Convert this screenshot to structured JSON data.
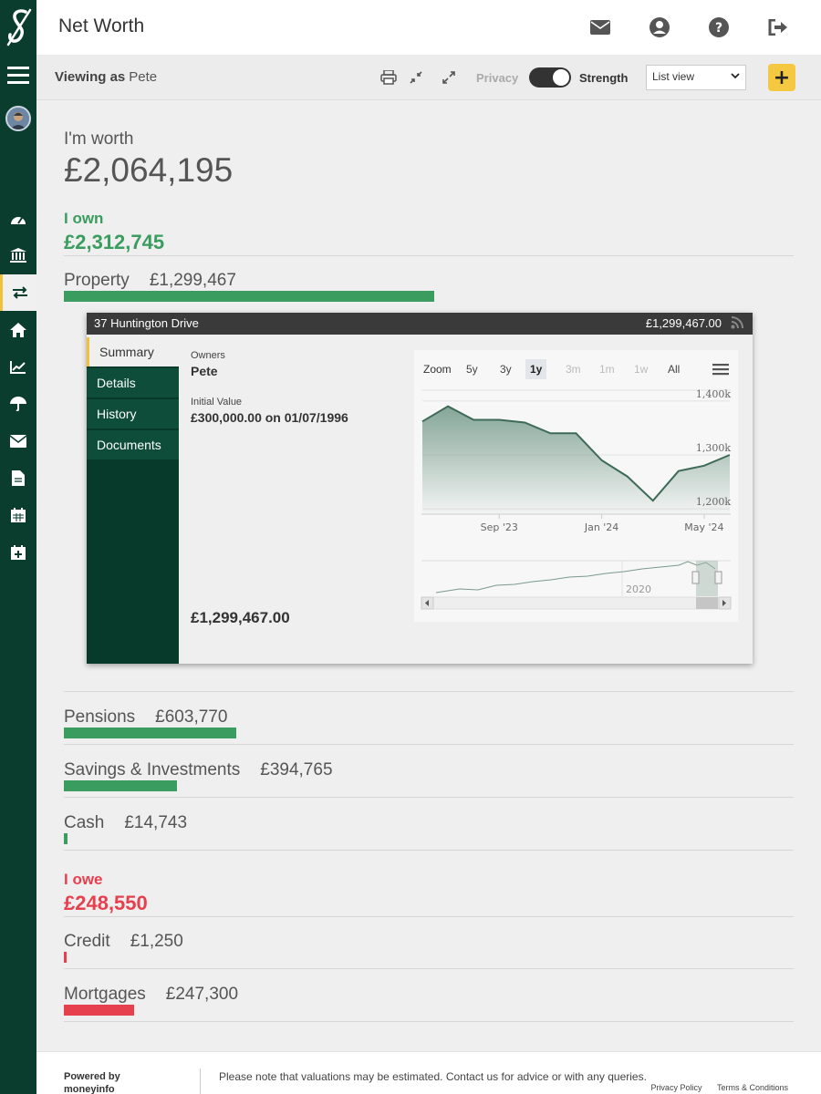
{
  "header": {
    "title": "Net Worth"
  },
  "toolbar": {
    "viewing_as_label": "Viewing as",
    "viewing_as_name": "Pete",
    "privacy_label": "Privacy",
    "strength_label": "Strength",
    "view_select_value": "List view",
    "privacy_enabled": true,
    "add_label": "+"
  },
  "summary": {
    "worth_label": "I'm worth",
    "worth_value": "£2,064,195",
    "own_label": "I own",
    "own_value": "£2,312,745",
    "owe_label": "I owe",
    "owe_value": "£248,550"
  },
  "assets": [
    {
      "name": "Property",
      "amount": "£1,299,467",
      "share": 0.562
    },
    {
      "name": "Pensions",
      "amount": "£603,770",
      "share": 0.261
    },
    {
      "name": "Savings & Investments",
      "amount": "£394,765",
      "share": 0.171
    },
    {
      "name": "Cash",
      "amount": "£14,743",
      "share": 0.006
    }
  ],
  "liabilities": [
    {
      "name": "Credit",
      "amount": "£1,250",
      "share": 0.005
    },
    {
      "name": "Mortgages",
      "amount": "£247,300",
      "share": 0.995
    }
  ],
  "property_panel": {
    "name": "37 Huntington Drive",
    "value": "£1,299,467.00",
    "tabs": [
      "Summary",
      "Details",
      "History",
      "Documents"
    ],
    "active_tab": "Summary",
    "owners_label": "Owners",
    "owners_value": "Pete",
    "initial_value_label": "Initial Value",
    "initial_value": "£300,000.00 on 01/07/1996",
    "current_value": "£1,299,467.00"
  },
  "chart_data": {
    "type": "area",
    "zoom_label": "Zoom",
    "zoom_options": [
      "5y",
      "3y",
      "1y",
      "3m",
      "1m",
      "1w",
      "All"
    ],
    "zoom_selected": "1y",
    "zoom_disabled": [
      "3m",
      "1m",
      "1w"
    ],
    "x": [
      "2023-06",
      "2023-07",
      "2023-08",
      "2023-09",
      "2023-10",
      "2023-11",
      "2023-12",
      "2024-01",
      "2024-02",
      "2024-03",
      "2024-04",
      "2024-05",
      "2024-06"
    ],
    "values": [
      1362000,
      1390000,
      1365000,
      1365000,
      1360000,
      1340000,
      1340000,
      1290000,
      1260000,
      1215000,
      1270000,
      1280000,
      1300000
    ],
    "x_ticks": [
      "Sep '23",
      "Jan '24",
      "May '24"
    ],
    "y_ticks": [
      "1,400k",
      "1,300k",
      "1,200k"
    ],
    "ylim": [
      1190000,
      1420000
    ],
    "navigator_label": "2020",
    "grid": true,
    "legend": "none"
  },
  "footer": {
    "powered_line1": "Powered by",
    "powered_line2": "moneyinfo",
    "note": "Please note that valuations may be estimated. Contact us for advice or with any queries.",
    "privacy_link": "Privacy Policy",
    "terms_link": "Terms & Conditions"
  }
}
